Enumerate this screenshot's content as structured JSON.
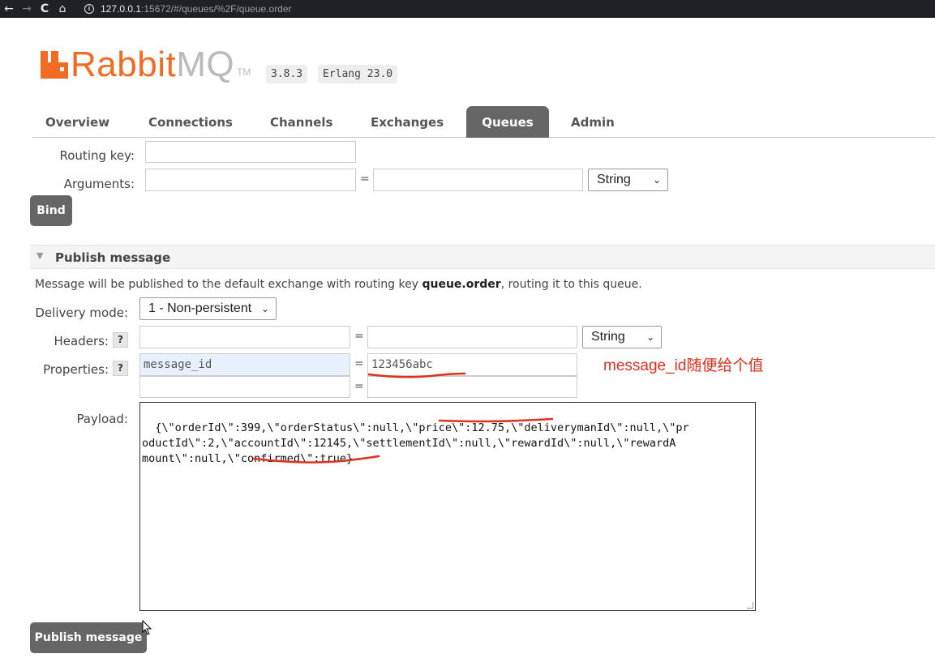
{
  "browser": {
    "back_icon": "←",
    "forward_icon": "→",
    "reload_icon": "C",
    "home_icon": "⌂",
    "url_host": "127.0.0.1",
    "url_path": ":15672/#/queues/%2F/queue.order"
  },
  "logo": {
    "brand_main": "Rabbit",
    "brand_accent": "MQ",
    "tm": "TM",
    "version": "3.8.3",
    "erlang": "Erlang 23.0"
  },
  "tabs": [
    {
      "label": "Overview",
      "active": false
    },
    {
      "label": "Connections",
      "active": false
    },
    {
      "label": "Channels",
      "active": false
    },
    {
      "label": "Exchanges",
      "active": false
    },
    {
      "label": "Queues",
      "active": true
    },
    {
      "label": "Admin",
      "active": false
    }
  ],
  "bind_form": {
    "routing_key_label": "Routing key:",
    "arguments_label": "Arguments:",
    "equals": "=",
    "arg_type": "String",
    "bind_button": "Bind"
  },
  "publish": {
    "section_title": "Publish message",
    "desc_prefix": "Message will be published to the default exchange with routing key ",
    "desc_key": "queue.order",
    "desc_suffix": ", routing it to this queue.",
    "delivery_mode_label": "Delivery mode:",
    "delivery_mode_value": "1 - Non-persistent",
    "headers_label": "Headers:",
    "header_type": "String",
    "properties_label": "Properties:",
    "help": "?",
    "equals": "=",
    "property_key": "message_id",
    "property_value": "123456abc",
    "payload_label": "Payload:",
    "payload": "{\\\"orderId\\\":399,\\\"orderStatus\\\":null,\\\"price\\\":12.75,\\\"deliverymanId\\\":null,\\\"pr\noductId\\\":2,\\\"accountId\\\":12145,\\\"settlementId\\\":null,\\\"rewardId\\\":null,\\\"rewardA\nmount\\\":null,\\\"confirmed\\\":true}",
    "publish_button": "Publish message"
  },
  "annotation": {
    "text": "message_id随便给个值",
    "color": "#e0301e"
  },
  "colors": {
    "brand_orange": "#f26b22",
    "tab_active_bg": "#666666",
    "button_bg": "#666666"
  }
}
